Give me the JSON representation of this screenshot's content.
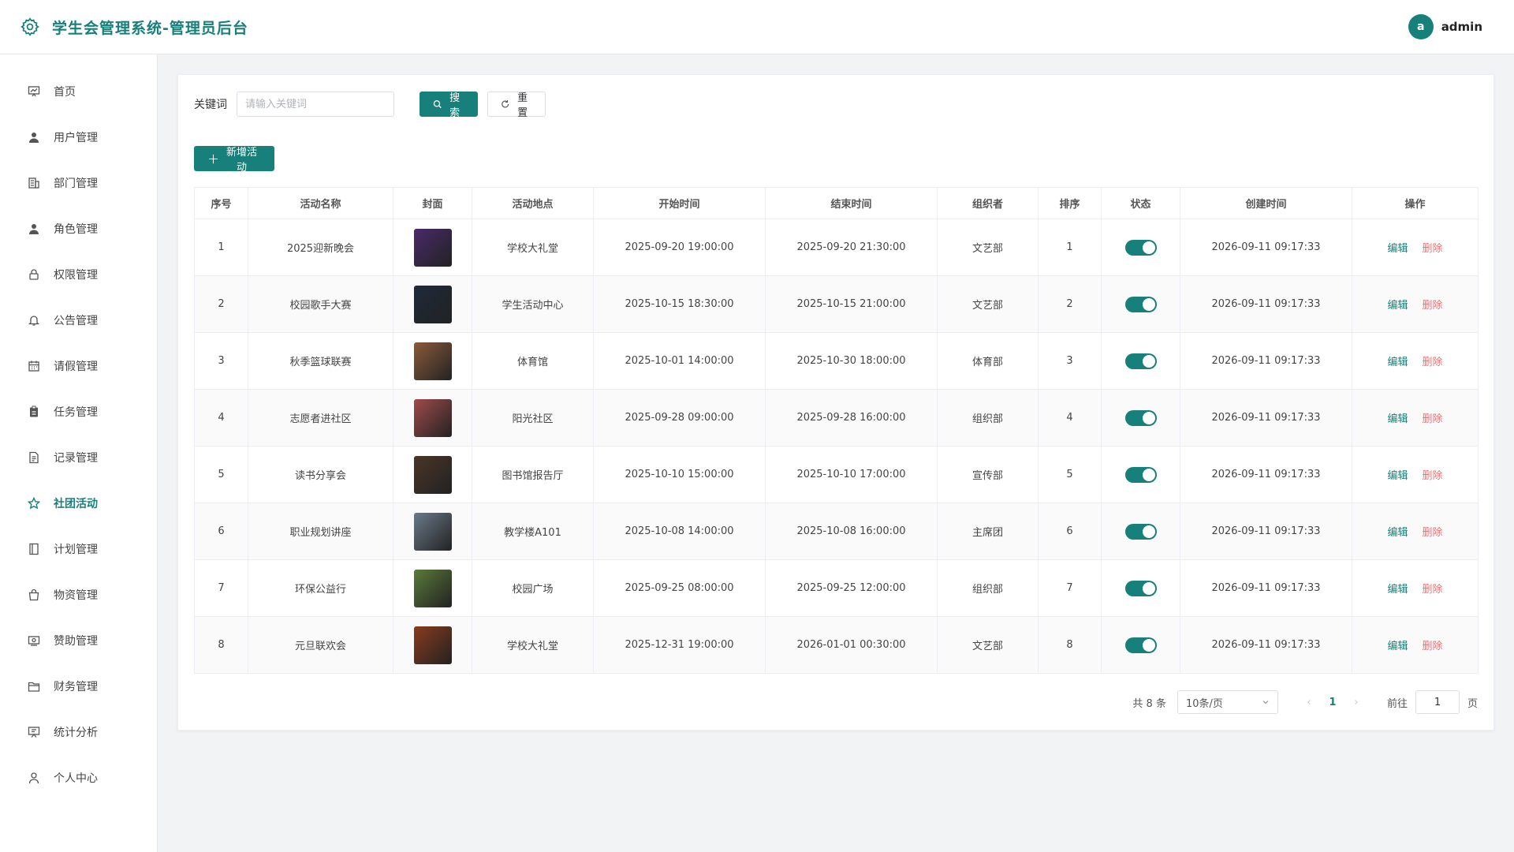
{
  "header": {
    "title": "学生会管理系统-管理员后台",
    "avatar_letter": "a",
    "username": "admin"
  },
  "sidebar": {
    "items": [
      {
        "label": "首页",
        "icon": "chart-board-icon"
      },
      {
        "label": "用户管理",
        "icon": "user-icon"
      },
      {
        "label": "部门管理",
        "icon": "building-icon"
      },
      {
        "label": "角色管理",
        "icon": "user-icon"
      },
      {
        "label": "权限管理",
        "icon": "lock-icon"
      },
      {
        "label": "公告管理",
        "icon": "bell-icon"
      },
      {
        "label": "请假管理",
        "icon": "calendar-icon"
      },
      {
        "label": "任务管理",
        "icon": "clipboard-icon"
      },
      {
        "label": "记录管理",
        "icon": "document-icon"
      },
      {
        "label": "社团活动",
        "icon": "star-icon",
        "active": true
      },
      {
        "label": "计划管理",
        "icon": "notebook-icon"
      },
      {
        "label": "物资管理",
        "icon": "bag-icon"
      },
      {
        "label": "赞助管理",
        "icon": "money-icon"
      },
      {
        "label": "财务管理",
        "icon": "folder-icon"
      },
      {
        "label": "统计分析",
        "icon": "monitor-icon"
      },
      {
        "label": "个人中心",
        "icon": "person-outline-icon"
      }
    ]
  },
  "search": {
    "label": "关键词",
    "placeholder": "请输入关键词",
    "search_btn": "搜索",
    "reset_btn": "重置"
  },
  "add_btn": "新增活动",
  "table": {
    "headers": [
      "序号",
      "活动名称",
      "封面",
      "活动地点",
      "开始时间",
      "结束时间",
      "组织者",
      "排序",
      "状态",
      "创建时间",
      "操作"
    ],
    "edit_label": "编辑",
    "delete_label": "删除",
    "rows": [
      {
        "no": "1",
        "name": "2025迎新晚会",
        "cover_color": "#4a2a6a",
        "place": "学校大礼堂",
        "start": "2025-09-20 19:00:00",
        "end": "2025-09-20 21:30:00",
        "org": "文艺部",
        "sort": "1",
        "created": "2026-09-11 09:17:33"
      },
      {
        "no": "2",
        "name": "校园歌手大赛",
        "cover_color": "#1e2a3a",
        "place": "学生活动中心",
        "start": "2025-10-15 18:30:00",
        "end": "2025-10-15 21:00:00",
        "org": "文艺部",
        "sort": "2",
        "created": "2026-09-11 09:17:33"
      },
      {
        "no": "3",
        "name": "秋季篮球联赛",
        "cover_color": "#8a5a3a",
        "place": "体育馆",
        "start": "2025-10-01 14:00:00",
        "end": "2025-10-30 18:00:00",
        "org": "体育部",
        "sort": "3",
        "created": "2026-09-11 09:17:33"
      },
      {
        "no": "4",
        "name": "志愿者进社区",
        "cover_color": "#a04a4a",
        "place": "阳光社区",
        "start": "2025-09-28 09:00:00",
        "end": "2025-09-28 16:00:00",
        "org": "组织部",
        "sort": "4",
        "created": "2026-09-11 09:17:33"
      },
      {
        "no": "5",
        "name": "读书分享会",
        "cover_color": "#4a3528",
        "place": "图书馆报告厅",
        "start": "2025-10-10 15:00:00",
        "end": "2025-10-10 17:00:00",
        "org": "宣传部",
        "sort": "5",
        "created": "2026-09-11 09:17:33"
      },
      {
        "no": "6",
        "name": "职业规划讲座",
        "cover_color": "#6a7a8a",
        "place": "教学楼A101",
        "start": "2025-10-08 14:00:00",
        "end": "2025-10-08 16:00:00",
        "org": "主席团",
        "sort": "6",
        "created": "2026-09-11 09:17:33"
      },
      {
        "no": "7",
        "name": "环保公益行",
        "cover_color": "#5a7a3a",
        "place": "校园广场",
        "start": "2025-09-25 08:00:00",
        "end": "2025-09-25 12:00:00",
        "org": "组织部",
        "sort": "7",
        "created": "2026-09-11 09:17:33"
      },
      {
        "no": "8",
        "name": "元旦联欢会",
        "cover_color": "#8a3a1e",
        "place": "学校大礼堂",
        "start": "2025-12-31 19:00:00",
        "end": "2026-01-01 00:30:00",
        "org": "文艺部",
        "sort": "8",
        "created": "2026-09-11 09:17:33"
      }
    ]
  },
  "pagination": {
    "total": "共 8 条",
    "page_size": "10条/页",
    "current_page": "1",
    "goto_label": "前往",
    "goto_value": "1",
    "unit": "页"
  },
  "accent_color": "#17807a"
}
